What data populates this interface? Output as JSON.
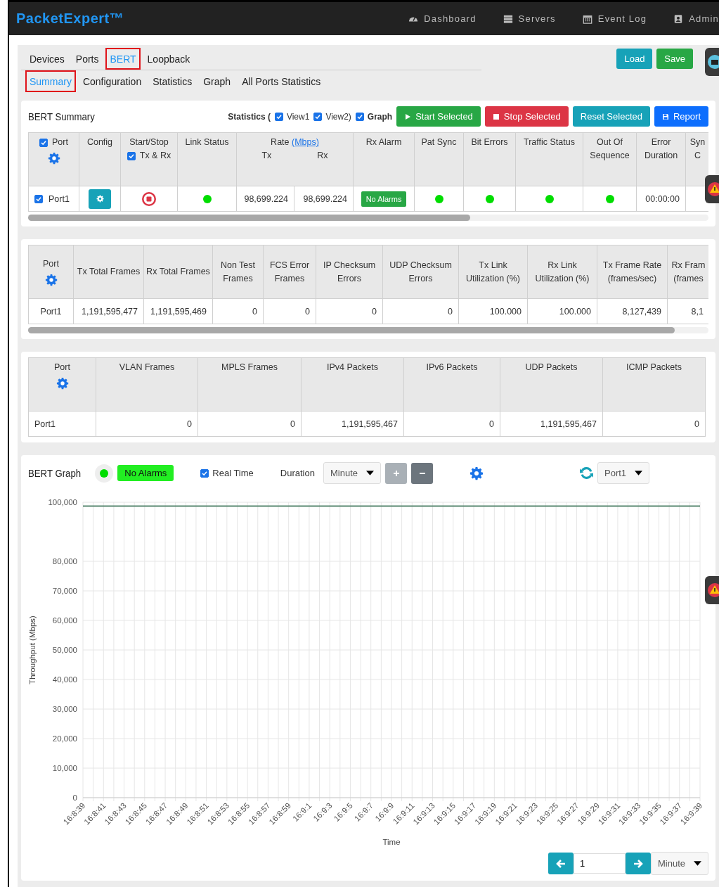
{
  "brand": "PacketExpert™",
  "nav": [
    {
      "label": "Dashboard",
      "kind": "gauge"
    },
    {
      "label": "Servers",
      "kind": "server"
    },
    {
      "label": "Event Log",
      "kind": "calendar"
    },
    {
      "label": "Admin",
      "kind": "user"
    }
  ],
  "tabs": [
    {
      "label": "Devices",
      "selected": false
    },
    {
      "label": "Ports",
      "selected": false
    },
    {
      "label": "BERT",
      "selected": true
    },
    {
      "label": "Loopback",
      "selected": false
    }
  ],
  "subtabs": [
    {
      "label": "Summary",
      "selected": true
    },
    {
      "label": "Configuration",
      "selected": false
    },
    {
      "label": "Statistics",
      "selected": false
    },
    {
      "label": "Graph",
      "selected": false
    },
    {
      "label": "All Ports Statistics",
      "selected": false
    }
  ],
  "actions": [
    {
      "label": "Load",
      "kind": "load"
    },
    {
      "label": "Save",
      "kind": "save"
    }
  ],
  "summary": {
    "title": "BERT Summary",
    "statistics_label": "Statistics (",
    "views": [
      {
        "label": "View1",
        "checked": true
      },
      {
        "label": "View2)",
        "checked": true
      },
      {
        "label": "Graph",
        "checked": true
      }
    ],
    "buttons": [
      {
        "label": "Start Selected",
        "kind": "start"
      },
      {
        "label": "Stop Selected",
        "kind": "stop"
      },
      {
        "label": "Reset Selected",
        "kind": "reset"
      },
      {
        "label": "Report",
        "kind": "report"
      }
    ],
    "columns": [
      {
        "kind": "port",
        "label": "Port",
        "checked": true
      },
      {
        "kind": "text",
        "label": "Config"
      },
      {
        "kind": "startstop",
        "label": "Start/Stop",
        "sublabel": "Tx & Rx",
        "checked": true
      },
      {
        "kind": "text",
        "label": "Link Status"
      },
      {
        "kind": "rate",
        "label": "Rate",
        "unit": "(Mbps)",
        "tx": "Tx",
        "rx": "Rx"
      },
      {
        "kind": "text",
        "label": "Rx Alarm"
      },
      {
        "kind": "text",
        "label": "Pat Sync"
      },
      {
        "kind": "text",
        "label": "Bit Errors"
      },
      {
        "kind": "text",
        "label": "Traffic Status"
      },
      {
        "kind": "text",
        "label": "Out Of Sequence"
      },
      {
        "kind": "text",
        "label": "Error Duration"
      },
      {
        "kind": "text",
        "label": "Syn C"
      }
    ],
    "row": {
      "port": "Port1",
      "checked": true,
      "cells": [
        {
          "kind": "config"
        },
        {
          "kind": "stop"
        },
        {
          "kind": "dot",
          "ok": true
        },
        {
          "kind": "text",
          "text": "98,699.224"
        },
        {
          "kind": "text",
          "text": "98,699.224"
        },
        {
          "kind": "badge",
          "text": "No Alarms"
        },
        {
          "kind": "dot",
          "ok": true
        },
        {
          "kind": "dot",
          "ok": true
        },
        {
          "kind": "dot",
          "ok": true
        },
        {
          "kind": "dot",
          "ok": true
        },
        {
          "kind": "text",
          "text": "00:00:00"
        },
        {
          "kind": "empty"
        }
      ]
    }
  },
  "stats": {
    "columns": [
      "Port",
      "Tx Total Frames",
      "Rx Total Frames",
      "Non Test Frames",
      "FCS Error Frames",
      "IP Checksum Errors",
      "UDP Checksum Errors",
      "Tx Link Utilization (%)",
      "Rx Link Utilization (%)",
      "Tx Frame Rate (frames/sec)",
      "Rx Fram (frames"
    ],
    "row": [
      "Port1",
      "1,191,595,477",
      "1,191,595,469",
      "0",
      "0",
      "0",
      "0",
      "100.000",
      "100.000",
      "8,127,439",
      "8,1"
    ]
  },
  "packets": {
    "columns": [
      "Port",
      "VLAN Frames",
      "MPLS Frames",
      "IPv4 Packets",
      "IPv6 Packets",
      "UDP Packets",
      "ICMP Packets"
    ],
    "row": [
      "Port1",
      "0",
      "0",
      "1,191,595,467",
      "0",
      "1,191,595,467",
      "0"
    ]
  },
  "graph": {
    "title": "BERT Graph",
    "ok": true,
    "alarm": "No Alarms",
    "real_time": {
      "label": "Real Time",
      "checked": true
    },
    "duration_label": "Duration",
    "duration": "Minute",
    "port": "Port1",
    "chart_data": {
      "type": "line",
      "xlabel": "Time",
      "ylabel": "Throughput (Mbps)",
      "categories": [
        "16:8:39",
        "16:8:41",
        "16:8:43",
        "16:8:45",
        "16:8:47",
        "16:8:49",
        "16:8:51",
        "16:8:53",
        "16:8:55",
        "16:8:57",
        "16:8:59",
        "16:9:1",
        "16:9:3",
        "16:9:5",
        "16:9:7",
        "16:9:9",
        "16:9:11",
        "16:9:13",
        "16:9:15",
        "16:9:17",
        "16:9:19",
        "16:9:21",
        "16:9:23",
        "16:9:25",
        "16:9:27",
        "16:9:29",
        "16:9:31",
        "16:9:33",
        "16:9:35",
        "16:9:37",
        "16:9:39"
      ],
      "series": [
        {
          "color": "#5b8a72",
          "values": [
            98700,
            98700,
            98700,
            98700,
            98700,
            98700,
            98700,
            98700,
            98700,
            98700,
            98700,
            98700,
            98700,
            98700,
            98700,
            98700,
            98700,
            98700,
            98700,
            98700,
            98700,
            98700,
            98700,
            98700,
            98700,
            98700,
            98700,
            98700,
            98700,
            98700,
            98700
          ]
        }
      ],
      "grid": true,
      "ylim": [
        0,
        100000
      ],
      "yticks": [
        {
          "value": 0,
          "label": "0"
        },
        {
          "value": 10000,
          "label": "10,000"
        },
        {
          "value": 20000,
          "label": "20,000"
        },
        {
          "value": 30000,
          "label": "30,000"
        },
        {
          "value": 40000,
          "label": "40,000"
        },
        {
          "value": 50000,
          "label": "50,000"
        },
        {
          "value": 60000,
          "label": "60,000"
        },
        {
          "value": 70000,
          "label": "70,000"
        },
        {
          "value": 80000,
          "label": "80,000"
        },
        {
          "value": 100000,
          "label": "100,000"
        }
      ]
    },
    "page": "1",
    "page_unit": "Minute"
  }
}
